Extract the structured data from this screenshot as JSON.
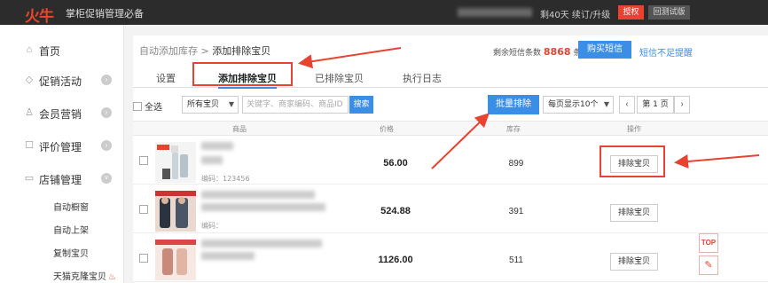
{
  "topbar": {
    "logo": "火牛",
    "tagline": "掌柜促销管理必备",
    "days_left": "剩40天 续订/升级",
    "auth_button": "授权",
    "old_version_button": "回测试版"
  },
  "sidebar": {
    "items": [
      {
        "label": "首页",
        "icon": "home-icon",
        "glyph": "⌂"
      },
      {
        "label": "促销活动",
        "icon": "tag-icon",
        "glyph": "◇"
      },
      {
        "label": "会员营销",
        "icon": "user-icon",
        "glyph": "♙"
      },
      {
        "label": "评价管理",
        "icon": "comment-icon",
        "glyph": "☐"
      },
      {
        "label": "店铺管理",
        "icon": "shop-icon",
        "glyph": "▭"
      }
    ],
    "arrow_glyph": "›",
    "expanded_arrow_glyph": "˅",
    "sub_items": [
      "自动橱窗",
      "自动上架",
      "复制宝贝",
      "天猫克隆宝贝"
    ]
  },
  "breadcrumb": {
    "parent": "自动添加库存",
    "separator": " > ",
    "current": "添加排除宝贝"
  },
  "sms": {
    "label": "剩余短信条数",
    "count": "8868",
    "unit": "条",
    "buy_button": "购买短信",
    "remind_link": "短信不足提醒"
  },
  "tabs": [
    "设置",
    "添加排除宝贝",
    "已排除宝贝",
    "执行日志"
  ],
  "active_tab": 1,
  "toolbar": {
    "select_all": "全选",
    "filter_value": "所有宝贝",
    "search_placeholder": "关键字、商家编码、商品ID",
    "search_button": "搜索",
    "batch_button": "批量排除",
    "page_size": "每页显示10个",
    "prev": "‹",
    "page": "第 1 页",
    "next": "›"
  },
  "table": {
    "headers": [
      "商品",
      "价格",
      "库存",
      "操作"
    ],
    "rows": [
      {
        "code": "编码：123456",
        "price": "56.00",
        "stock": "899",
        "action": "排除宝贝"
      },
      {
        "code": "编码：",
        "price": "524.88",
        "stock": "391",
        "action": "排除宝贝"
      },
      {
        "code": "",
        "price": "1126.00",
        "stock": "511",
        "action": "排除宝贝"
      }
    ]
  },
  "float": {
    "top": "TOP",
    "edit_glyph": "✎"
  },
  "colors": {
    "accent_blue": "#3a8ee6",
    "highlight_red": "#e84330",
    "topbar": "#2c2c2c"
  }
}
